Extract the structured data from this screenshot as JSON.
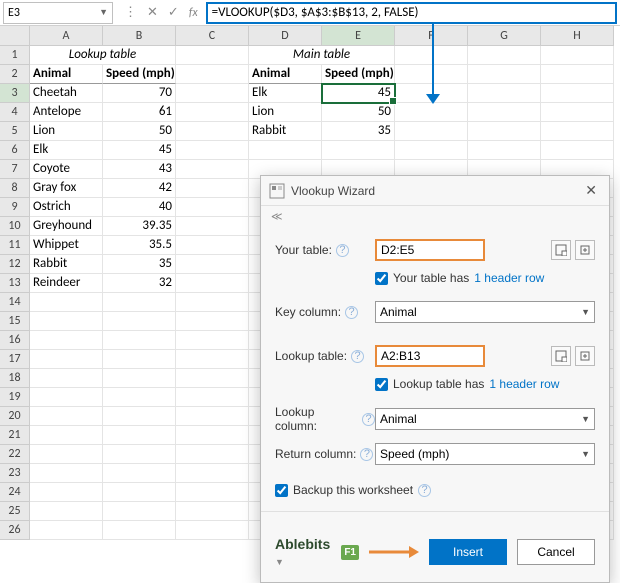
{
  "name_box": "E3",
  "formula": "=VLOOKUP($D3, $A$3:$B$13, 2, FALSE)",
  "col_headers": [
    "A",
    "B",
    "C",
    "D",
    "E",
    "F",
    "G",
    "H"
  ],
  "row_count": 26,
  "lookup_title": "Lookup table",
  "main_title": "Main table",
  "headers": {
    "animal": "Animal",
    "speed": "Speed (mph)"
  },
  "lookup_rows": [
    {
      "animal": "Cheetah",
      "speed": "70"
    },
    {
      "animal": "Antelope",
      "speed": "61"
    },
    {
      "animal": "Lion",
      "speed": "50"
    },
    {
      "animal": "Elk",
      "speed": "45"
    },
    {
      "animal": "Coyote",
      "speed": "43"
    },
    {
      "animal": "Gray fox",
      "speed": "42"
    },
    {
      "animal": "Ostrich",
      "speed": "40"
    },
    {
      "animal": "Greyhound",
      "speed": "39.35"
    },
    {
      "animal": "Whippet",
      "speed": "35.5"
    },
    {
      "animal": "Rabbit",
      "speed": "35"
    },
    {
      "animal": "Reindeer",
      "speed": "32"
    }
  ],
  "main_rows": [
    {
      "animal": "Elk",
      "speed": "45"
    },
    {
      "animal": "Lion",
      "speed": "50"
    },
    {
      "animal": "Rabbit",
      "speed": "35"
    }
  ],
  "wizard": {
    "title": "Vlookup Wizard",
    "labels": {
      "your_table": "Your table:",
      "key_column": "Key column:",
      "lookup_table": "Lookup table:",
      "lookup_column": "Lookup column:",
      "return_column": "Return column:"
    },
    "values": {
      "your_table": "D2:E5",
      "key_column": "Animal",
      "lookup_table": "A2:B13",
      "lookup_column": "Animal",
      "return_column": "Speed (mph)"
    },
    "sub": {
      "your_table_has": "Your table has",
      "lookup_table_has": "Lookup table has",
      "header_row_link": "1 header row",
      "backup": "Backup this worksheet"
    },
    "brand": "Ablebits",
    "f1": "F1",
    "buttons": {
      "insert": "Insert",
      "cancel": "Cancel"
    }
  }
}
